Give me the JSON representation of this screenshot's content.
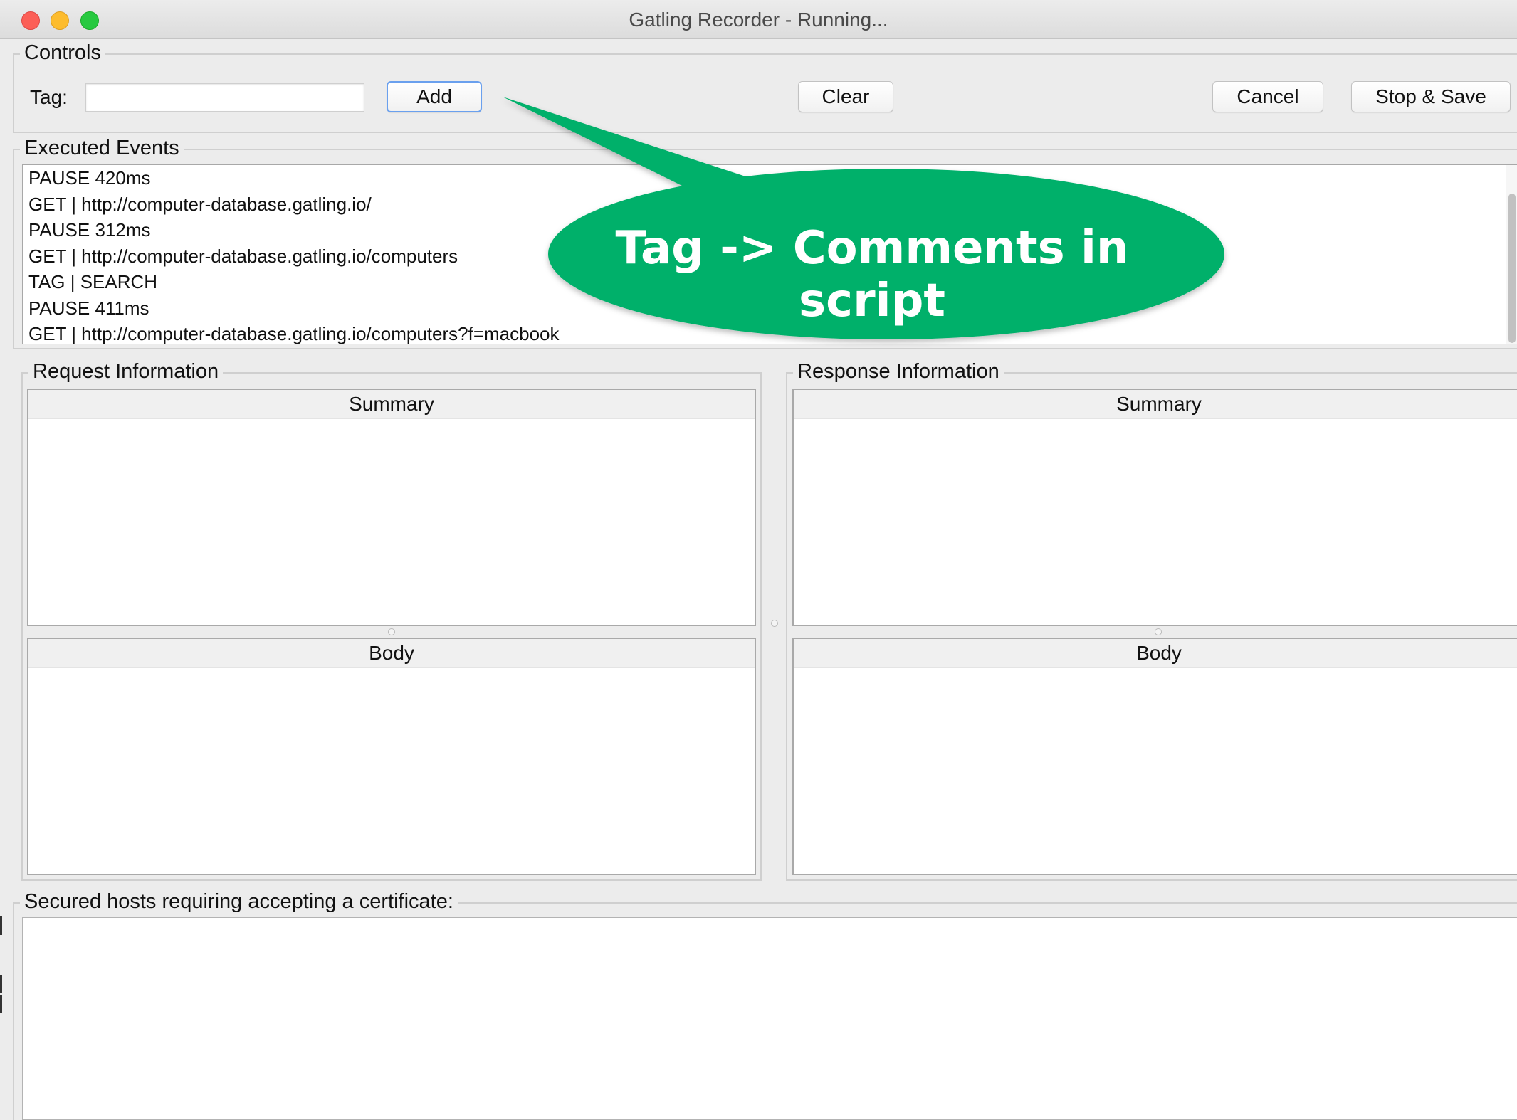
{
  "window": {
    "title": "Gatling Recorder - Running..."
  },
  "controls": {
    "legend": "Controls",
    "tag_label": "Tag:",
    "tag_value": "",
    "tag_placeholder": "",
    "add_label": "Add",
    "clear_label": "Clear",
    "cancel_label": "Cancel",
    "stop_save_label": "Stop & Save"
  },
  "executed_events": {
    "legend": "Executed Events",
    "items": [
      "PAUSE 420ms",
      "GET | http://computer-database.gatling.io/",
      "PAUSE 312ms",
      "GET | http://computer-database.gatling.io/computers",
      "TAG | SEARCH",
      "PAUSE 411ms",
      "GET | http://computer-database.gatling.io/computers?f=macbook"
    ]
  },
  "request_info": {
    "legend": "Request Information",
    "summary_header": "Summary",
    "body_header": "Body"
  },
  "response_info": {
    "legend": "Response Information",
    "summary_header": "Summary",
    "body_header": "Body"
  },
  "secured_hosts": {
    "legend": "Secured hosts requiring accepting a certificate:"
  },
  "callout": {
    "text": "Tag -> Comments in script",
    "color": "#00b06b"
  },
  "colors": {
    "traffic_close": "#fc5f57",
    "traffic_minimize": "#fdbc2e",
    "traffic_maximize": "#27c940",
    "focus_ring": "#6aa0ee"
  }
}
